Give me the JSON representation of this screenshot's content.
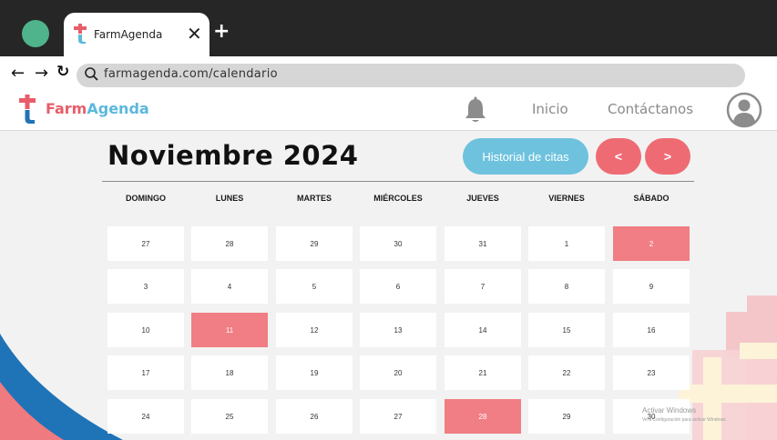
{
  "browser": {
    "tab_title": "FarmAgenda",
    "close_glyph": "✕",
    "new_tab_glyph": "+",
    "back_glyph": "←",
    "forward_glyph": "→",
    "reload_glyph": "↻",
    "url": "farmagenda.com/calendario"
  },
  "header": {
    "brand_part1": "Farm",
    "brand_part2": "Agenda",
    "nav": [
      "Inicio",
      "Contáctanos"
    ],
    "icons": [
      "bell-icon",
      "user-avatar-icon"
    ]
  },
  "calendar": {
    "title": "Noviembre 2024",
    "history_button": "Historial de citas",
    "prev_button": "<",
    "next_button": ">",
    "weekdays": [
      "DOMINGO",
      "LUNES",
      "MARTES",
      "MIÉRCOLES",
      "JUEVES",
      "VIERNES",
      "SÁBADO"
    ],
    "weeks": [
      [
        "27",
        "28",
        "29",
        "30",
        "31",
        "1",
        "2"
      ],
      [
        "3",
        "4",
        "5",
        "6",
        "7",
        "8",
        "9"
      ],
      [
        "10",
        "11",
        "12",
        "13",
        "14",
        "15",
        "16"
      ],
      [
        "17",
        "18",
        "19",
        "20",
        "21",
        "22",
        "23"
      ],
      [
        "24",
        "25",
        "26",
        "27",
        "28",
        "29",
        "30"
      ]
    ],
    "highlighted": [
      [
        0,
        6
      ],
      [
        2,
        1
      ],
      [
        4,
        4
      ]
    ]
  },
  "watermark": {
    "line1": "Activar Windows",
    "line2": "Ve a Configuración para activar Windows."
  },
  "colors": {
    "accent_red": "#ef6b73",
    "highlight": "#f07e84",
    "accent_blue": "#6ec2de",
    "brand_blue": "#5bb8dc",
    "deco_dark_blue": "#1f73b7"
  }
}
